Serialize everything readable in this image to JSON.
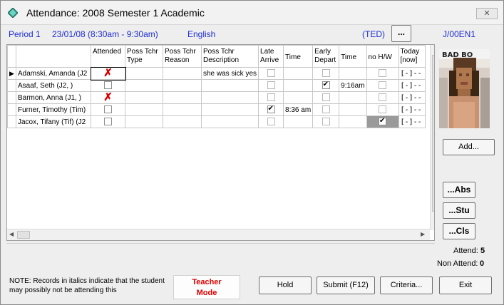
{
  "window": {
    "title": "Attendance: 2008 Semester 1 Academic",
    "close_label": "✕"
  },
  "info": {
    "period": "Period 1",
    "datetime": "23/01/08 (8:30am - 9:30am)",
    "subject": "English",
    "teacher": "(TED)",
    "dots_label": "...",
    "code": "J/00EN1"
  },
  "grid": {
    "headers": {
      "name": "",
      "attended": "Attended",
      "poss_type": [
        "Poss Tchr",
        "Type"
      ],
      "poss_reason": [
        "Poss Tchr",
        "Reason"
      ],
      "poss_desc": [
        "Poss Tchr",
        "Description"
      ],
      "late": [
        "Late",
        "Arrive"
      ],
      "late_time": "Time",
      "early": [
        "Early",
        "Depart"
      ],
      "early_time": "Time",
      "nohw": "no H/W",
      "today": [
        "Today",
        "[now]"
      ]
    },
    "rows": [
      {
        "name": "Adamski, Amanda (J2",
        "attended": "x",
        "desc": "she was sick yes",
        "late": false,
        "late_time": "",
        "early": false,
        "early_time": "",
        "nohw": false,
        "today": "[-]--"
      },
      {
        "name": "Asaaf, Seth (J2, )",
        "attended": "empty",
        "desc": "",
        "late": false,
        "late_time": "",
        "early": true,
        "early_time": "9:16am",
        "nohw": false,
        "today": "[-]--"
      },
      {
        "name": "Barmon, Anna (J1, )",
        "attended": "x",
        "desc": "",
        "late": false,
        "late_time": "",
        "early": false,
        "early_time": "",
        "nohw": false,
        "today": "[-]--"
      },
      {
        "name": "Furner, Timothy (Tim)",
        "attended": "empty",
        "desc": "",
        "late": true,
        "late_time": "8:36 am",
        "early": false,
        "early_time": "",
        "nohw": false,
        "today": "[-]--"
      },
      {
        "name": "Jacox, Tifany (Tif) (J2",
        "attended": "empty",
        "desc": "",
        "late": false,
        "late_time": "",
        "early": false,
        "early_time": "",
        "nohw": true,
        "today": "[-]--"
      }
    ]
  },
  "side": {
    "add_label": "Add...",
    "abs_label": "...Abs",
    "stu_label": "...Stu",
    "cls_label": "...Cls"
  },
  "counts": {
    "attend_label": "Attend:",
    "attend_value": "5",
    "non_attend_label": "Non Attend:",
    "non_attend_value": "0"
  },
  "note": "NOTE:  Records in italics indicate that the student may possibly not be attending this",
  "teacher_mode": [
    "Teacher",
    "Mode"
  ],
  "buttons": {
    "hold": "Hold",
    "submit": "Submit (F12)",
    "criteria": "Criteria...",
    "exit": "Exit"
  }
}
